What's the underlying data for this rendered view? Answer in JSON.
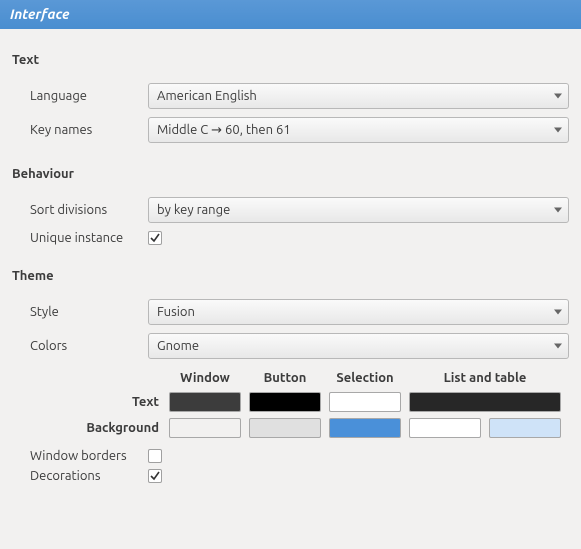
{
  "title": "Interface",
  "sections": {
    "text": {
      "heading": "Text",
      "language_label": "Language",
      "language_value": "American English",
      "keynames_label": "Key names",
      "keynames_value": "Middle C → 60, then 61"
    },
    "behaviour": {
      "heading": "Behaviour",
      "sort_label": "Sort divisions",
      "sort_value": "by key range",
      "unique_label": "Unique instance",
      "unique_checked": true
    },
    "theme": {
      "heading": "Theme",
      "style_label": "Style",
      "style_value": "Fusion",
      "colors_label": "Colors",
      "colors_value": "Gnome",
      "table": {
        "col_window": "Window",
        "col_button": "Button",
        "col_selection": "Selection",
        "col_list": "List and table",
        "row_text": "Text",
        "row_background": "Background",
        "swatches": {
          "text_window": "#3c3c3c",
          "text_button": "#000000",
          "text_selection": "#ffffff",
          "text_list": "#272727",
          "bg_window": "#f2f1f0",
          "bg_button": "#e0e0e0",
          "bg_selection": "#4a90d9",
          "bg_list": "#ffffff",
          "bg_list_alt": "#cfe3f8"
        }
      },
      "window_borders_label": "Window borders",
      "window_borders_checked": false,
      "decorations_label": "Decorations",
      "decorations_checked": true
    }
  }
}
